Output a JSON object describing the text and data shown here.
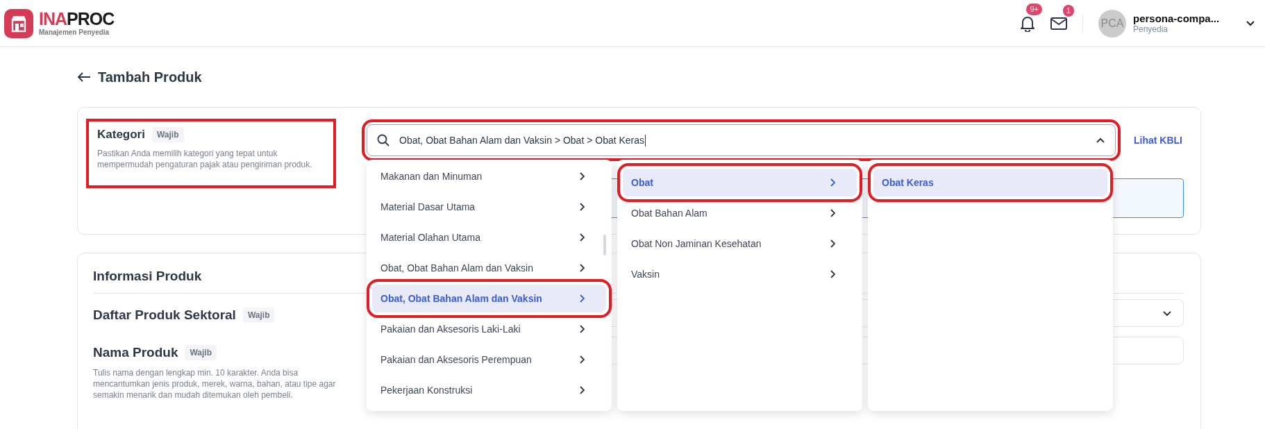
{
  "header": {
    "brand_primary": "INA",
    "brand_secondary": "PROC",
    "subtitle": "Manajemen Penyedia",
    "notification_badge": "9+",
    "message_badge": "1",
    "user": {
      "initials": "PCA",
      "name": "persona-compa...",
      "role": "Penyedia"
    }
  },
  "page_title": "Tambah Produk",
  "kategori": {
    "label": "Kategori",
    "badge": "Wajib",
    "description": "Pastikan Anda memilih kategori yang tepat untuk mempermudah pengaturan pajak atau pengiriman produk.",
    "highlighted": true,
    "search": {
      "value": "Obat, Obat Bahan Alam dan Vaksin > Obat > Obat Keras",
      "highlighted": true,
      "expanded": true
    },
    "link": "Lihat KBLI"
  },
  "category_columns": [
    {
      "items": [
        {
          "label": "Makanan dan Minuman",
          "selected": false,
          "highlighted": false
        },
        {
          "label": "Material Dasar Utama",
          "selected": false,
          "highlighted": false
        },
        {
          "label": "Material Olahan Utama",
          "selected": false,
          "highlighted": false
        },
        {
          "label": "Obat, Obat Bahan Alam dan Vaksin",
          "selected": false,
          "highlighted": false
        },
        {
          "label": "Obat, Obat Bahan Alam dan Vaksin",
          "selected": true,
          "highlighted": true
        },
        {
          "label": "Pakaian dan Aksesoris Laki-Laki",
          "selected": false,
          "highlighted": false
        },
        {
          "label": "Pakaian dan Aksesoris Perempuan",
          "selected": false,
          "highlighted": false
        },
        {
          "label": "Pekerjaan Konstruksi",
          "selected": false,
          "highlighted": false
        }
      ]
    },
    {
      "items": [
        {
          "label": "Obat",
          "selected": true,
          "highlighted": true
        },
        {
          "label": "Obat Bahan Alam",
          "selected": false,
          "highlighted": false
        },
        {
          "label": "Obat Non Jaminan Kesehatan",
          "selected": false,
          "highlighted": false
        },
        {
          "label": "Vaksin",
          "selected": false,
          "highlighted": false
        }
      ]
    },
    {
      "items": [
        {
          "label": "Obat Keras",
          "selected": true,
          "highlighted": true,
          "leaf": true
        }
      ]
    }
  ],
  "informasi_produk": {
    "title": "Informasi Produk",
    "fields": [
      {
        "kind": "select",
        "label": "Daftar Produk Sektoral",
        "badge": "Wajib"
      },
      {
        "kind": "text",
        "label": "Nama Produk",
        "badge": "Wajib",
        "description": "Tulis nama dengan lengkap min. 10 karakter. Anda bisa mencantumkan jenis produk, merek, warna, bahan, atau tipe agar semakin menarik dan mudah ditemukan oleh pembeli."
      }
    ]
  }
}
